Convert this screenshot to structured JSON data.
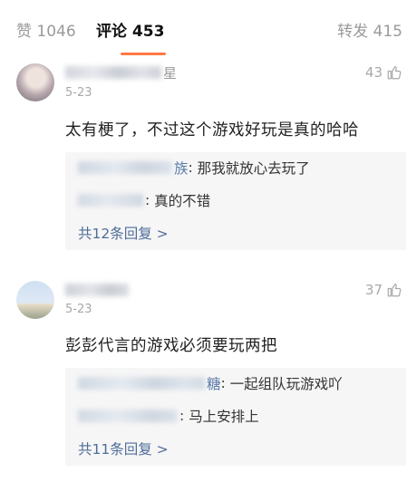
{
  "tabs": [
    {
      "label": "赞 1046"
    },
    {
      "label": "评论 453"
    },
    {
      "label": "转发 415"
    }
  ],
  "comments": [
    {
      "name_visible": "星",
      "date": "5-23",
      "likes": "43",
      "text": "太有梗了，不过这个游戏好玩是真的哈哈",
      "replies": [
        {
          "name_visible": "族",
          "text": "那我就放心去玩了"
        },
        {
          "name_visible": "",
          "text": "真的不错"
        }
      ],
      "more": "共12条回复 >"
    },
    {
      "name_visible": "",
      "date": "5-23",
      "likes": "37",
      "text": "彭彭代言的游戏必须要玩两把",
      "replies": [
        {
          "name_visible": "糖",
          "text": "一起组队玩游戏吖"
        },
        {
          "name_visible": "",
          "text": "马上安排上"
        }
      ],
      "more": "共11条回复 >"
    }
  ],
  "icons": [
    "thumb-up-icon"
  ],
  "colors": {
    "accent": "#ff7a45",
    "link": "#4f6d9a",
    "muted": "#9a9a9a"
  }
}
